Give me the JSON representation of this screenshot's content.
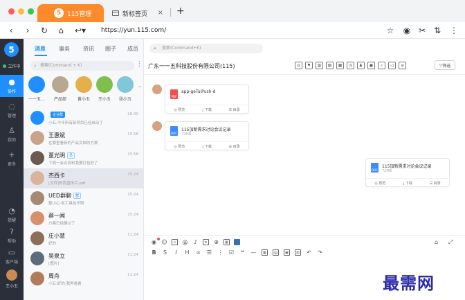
{
  "browser": {
    "tabs": [
      {
        "title": "115管理",
        "logo": "5"
      },
      {
        "title": "新标签页"
      }
    ],
    "tab_close": "×",
    "new_tab": "+",
    "url": "https://yun.115.com/"
  },
  "nav": {
    "brand": "5",
    "work_status": "工作中",
    "items": [
      {
        "label": "协作",
        "icon": "chat-bubble-icon"
      },
      {
        "label": "管理",
        "icon": "chat-circle-icon"
      },
      {
        "label": "我的",
        "icon": "person-icon"
      },
      {
        "label": "更多",
        "icon": "plus-icon"
      },
      {
        "label": "提醒",
        "icon": "bell-icon"
      },
      {
        "label": "帮助",
        "icon": "help-icon"
      },
      {
        "label": "客户端",
        "icon": "desktop-icon"
      }
    ],
    "user_name": "王小五"
  },
  "list": {
    "tabs": [
      "消息",
      "事务",
      "资讯",
      "圈子",
      "成员"
    ],
    "search_placeholder": "搜索(Command + K)",
    "more": "⋮",
    "favorites": [
      {
        "name": "一一五..."
      },
      {
        "name": "产品部"
      },
      {
        "name": "黄小五"
      },
      {
        "name": "王小五"
      },
      {
        "name": "张小五"
      }
    ],
    "chats": [
      {
        "name": "",
        "tag": "企业群",
        "msg": "小五:今年所有新项目已经启动了",
        "time": "16:30"
      },
      {
        "name": "王惠斌",
        "tag": "",
        "msg": "在哪里看新的产品文档的方案",
        "time": "15:58"
      },
      {
        "name": "董光明",
        "tag": "员",
        "msg": "下周一会议资料我要打包好了",
        "time": "15:58"
      },
      {
        "name": "杰西卡",
        "tag": "",
        "msg": "[文件]时尚宣传片.pdf",
        "time": "15:24"
      },
      {
        "name": "UED群聊",
        "tag": "群",
        "msg": "整小心:有工具包不限",
        "time": "15:24"
      },
      {
        "name": "蔡一闻",
        "tag": "",
        "msg": "方案已经确认了",
        "time": "15:24"
      },
      {
        "name": "庄小慧",
        "tag": "",
        "msg": "好的",
        "time": "11:24"
      },
      {
        "name": "吴泉立",
        "tag": "",
        "msg": "[图片]",
        "time": "11:24"
      },
      {
        "name": "周舟",
        "tag": "",
        "msg": "小五:好的,我再看看",
        "time": "11:24"
      }
    ]
  },
  "main": {
    "search_placeholder": "搜索(Command+K)",
    "title": "广东一一五科技股份有限公司(115)",
    "filter_label": "筛选",
    "messages": [
      {
        "file": "app-geTuiPush-d",
        "size": "",
        "type": "PDF"
      },
      {
        "file": "115加新需求讨论会议记录",
        "size": "72MB",
        "type": "DOC"
      },
      {
        "file": "115加新需求讨论会议记录",
        "size": "72MB",
        "type": "DOC"
      }
    ],
    "card_actions": [
      "◎ 预览",
      "⤓ 下载",
      "☰ 目录"
    ],
    "composer": {
      "format": [
        "B",
        "S",
        "I",
        "H"
      ]
    }
  },
  "watermark": "最需网",
  "colors": {
    "accent": "#1f8fff",
    "tab_orange": "#ff8a2b",
    "nav_dark": "#2b2f3a",
    "watermark": "#2d2ca8"
  }
}
